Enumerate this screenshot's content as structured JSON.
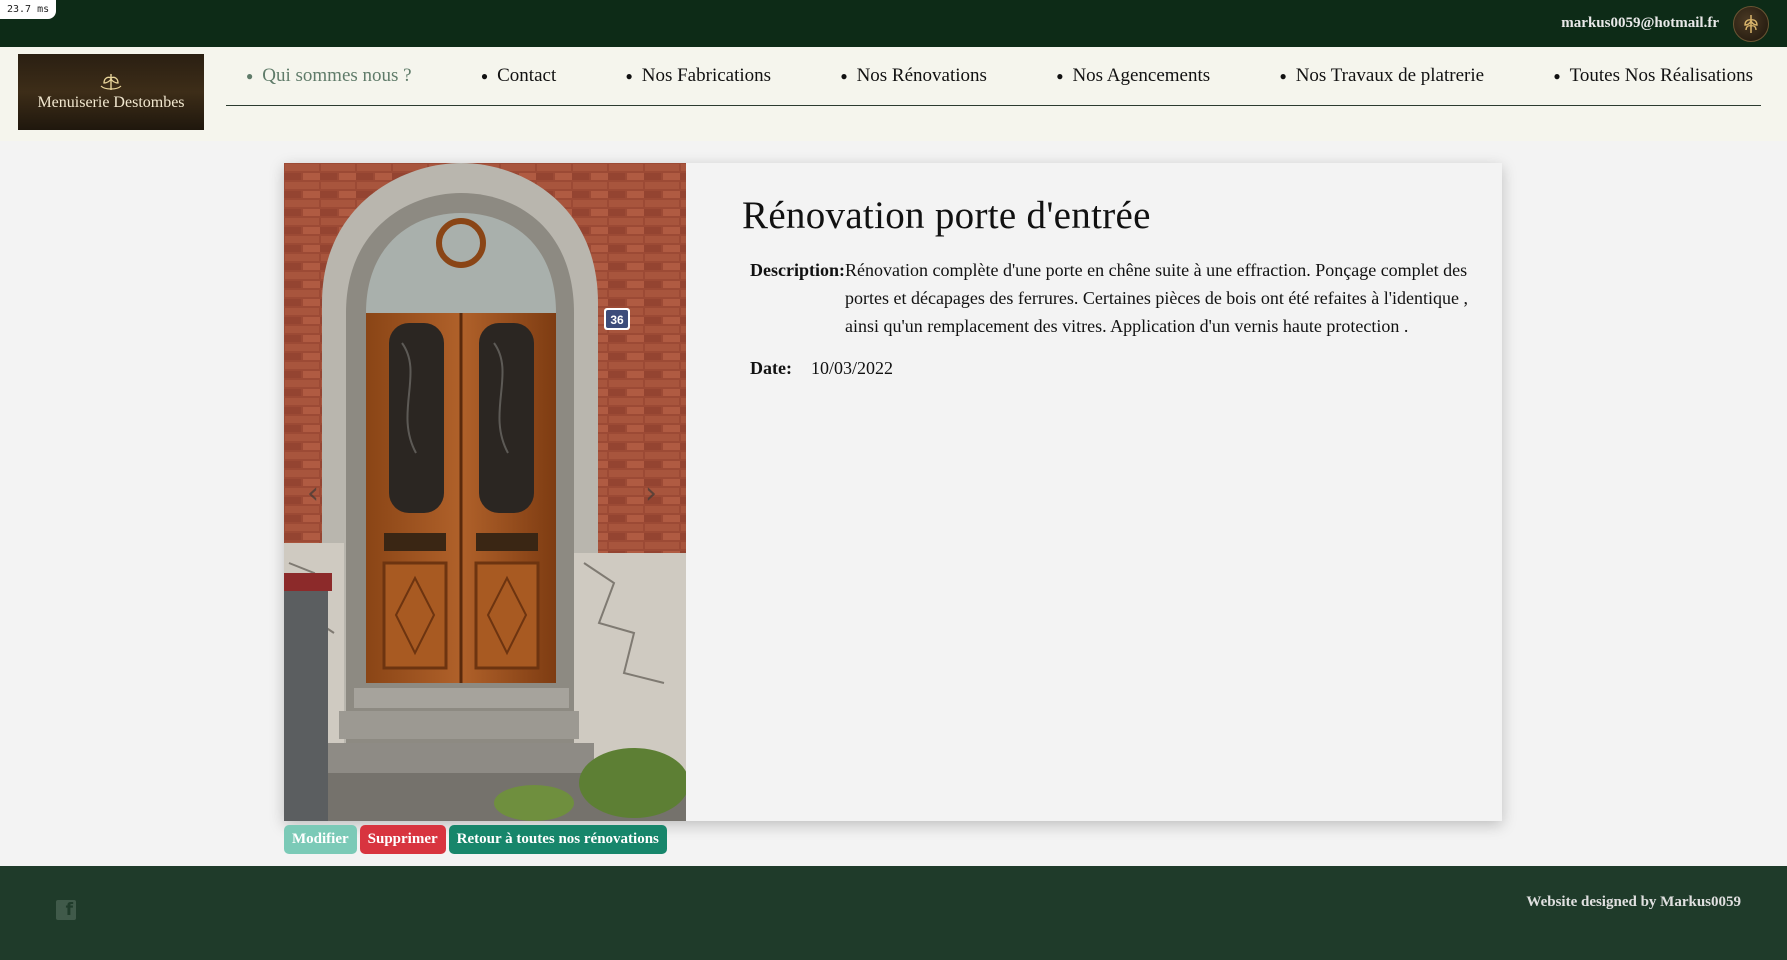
{
  "debug": {
    "render_time": "23.7 ms"
  },
  "topbar": {
    "user_email": "markus0059@hotmail.fr",
    "avatar_icon": "wheat-emblem-icon"
  },
  "header": {
    "logo_text": "Menuiserie Destombes",
    "nav": [
      {
        "label": "Qui sommes nous ?",
        "active": true
      },
      {
        "label": "Contact"
      },
      {
        "label": "Nos Fabrications"
      },
      {
        "label": "Nos Rénovations"
      },
      {
        "label": "Nos Agencements"
      },
      {
        "label": "Nos Travaux de platrerie"
      },
      {
        "label": "Toutes Nos Réalisations"
      }
    ]
  },
  "card": {
    "title": "Rénovation porte d'entrée",
    "description_label": "Description:",
    "description": "Rénovation complète d'une porte en chêne suite à une effraction. Ponçage complet des portes et décapages des ferrures. Certaines pièces de bois ont été refaites à l'identique , ainsi qu'un remplacement des vitres. Application d'un vernis haute protection .",
    "date_label": "Date:",
    "date": "10/03/2022",
    "house_number": "36",
    "carousel": {
      "prev_icon": "chevron-left-icon",
      "next_icon": "chevron-right-icon"
    }
  },
  "actions": {
    "edit": "Modifier",
    "delete": "Supprimer",
    "back": "Retour à toutes nos rénovations"
  },
  "footer": {
    "facebook_icon": "facebook-icon",
    "credit": "Website designed by Markus0059"
  },
  "colors": {
    "topbar": "#0d2b17",
    "footer": "#1f3b2a",
    "header_bg": "#f5f5ed",
    "edit_button": "#7bcab7",
    "delete_button": "#d8343f",
    "back_button": "#17866b"
  }
}
